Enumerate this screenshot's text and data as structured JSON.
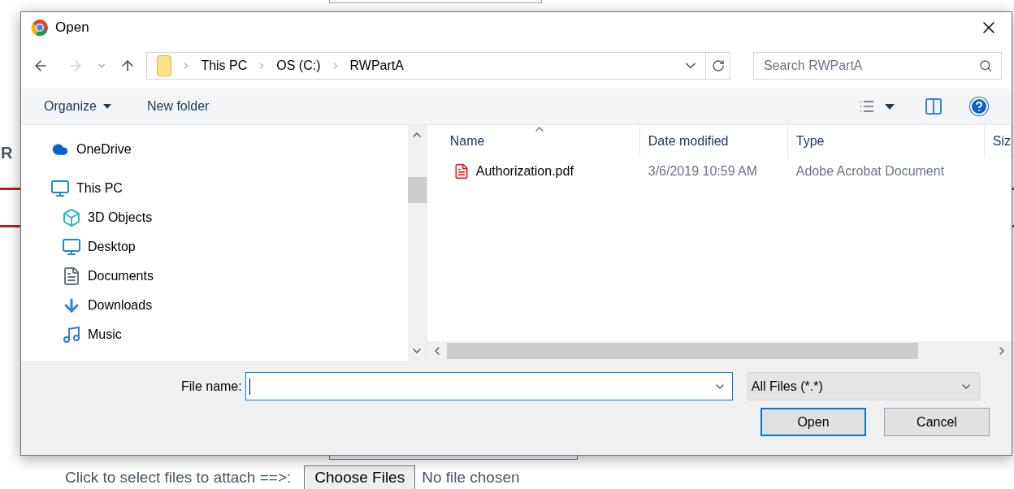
{
  "background_page": {
    "heading_fragment": "R",
    "attach_label": "Click to select files to attach ==>:",
    "choose_button": "Choose Files",
    "file_status": "No file chosen"
  },
  "dialog": {
    "title": "Open",
    "breadcrumb": [
      "This PC",
      "OS (C:)",
      "RWPartA"
    ],
    "search": {
      "placeholder": "Search RWPartA"
    },
    "toolbar": [
      "Organize",
      "New folder"
    ],
    "nav_tree": [
      {
        "label": "OneDrive"
      },
      {
        "label": "This PC",
        "children": [
          {
            "label": "3D Objects"
          },
          {
            "label": "Desktop"
          },
          {
            "label": "Documents"
          },
          {
            "label": "Downloads"
          },
          {
            "label": "Music"
          }
        ]
      }
    ],
    "columns": [
      "Name",
      "Date modified",
      "Type",
      "Siz"
    ],
    "files": [
      {
        "name": "Authorization.pdf",
        "date": "3/6/2019 10:59 AM",
        "type": "Adobe Acrobat Document",
        "selected": false
      }
    ],
    "file_name": {
      "label": "File name:"
    },
    "filter": "All Files (*.*)",
    "buttons": [
      {
        "label": "Open",
        "default": true
      },
      {
        "label": "Cancel",
        "default": false
      }
    ]
  }
}
